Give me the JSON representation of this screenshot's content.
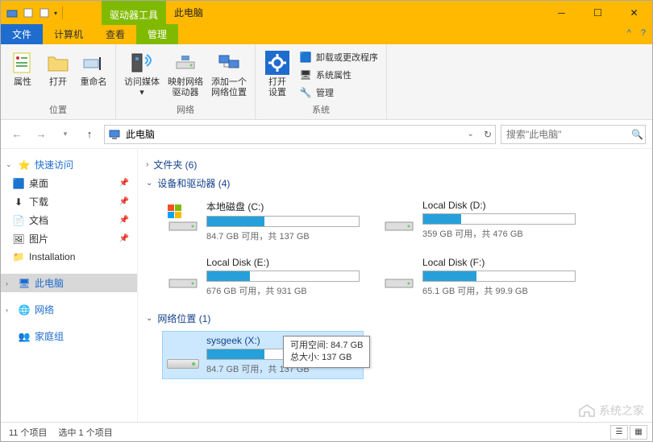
{
  "titlebar": {
    "contextual_tab": "驱动器工具",
    "title": "此电脑"
  },
  "tabs": {
    "file": "文件",
    "computer": "计算机",
    "view": "查看",
    "manage": "管理"
  },
  "ribbon": {
    "g1": {
      "properties": "属性",
      "open": "打开",
      "rename": "重命名",
      "group": "位置"
    },
    "g2": {
      "access_media": "访问媒体",
      "map_drive": "映射网络\n驱动器",
      "add_location": "添加一个\n网络位置",
      "group": "网络"
    },
    "g3": {
      "open_settings": "打开\n设置",
      "uninstall": "卸载或更改程序",
      "sys_props": "系统属性",
      "manage": "管理",
      "group": "系统"
    }
  },
  "address": {
    "path": "此电脑",
    "search_placeholder": "搜索\"此电脑\""
  },
  "nav": {
    "quick": "快速访问",
    "desktop": "桌面",
    "downloads": "下载",
    "documents": "文档",
    "pictures": "图片",
    "installation": "Installation",
    "this_pc": "此电脑",
    "network": "网络",
    "homegroup": "家庭组"
  },
  "sections": {
    "folders": "文件夹 (6)",
    "devices": "设备和驱动器 (4)",
    "netloc": "网络位置 (1)"
  },
  "drives": [
    {
      "name": "本地磁盘 (C:)",
      "stat": "84.7 GB 可用，共 137 GB",
      "fill": 38,
      "win": true
    },
    {
      "name": "Local Disk (D:)",
      "stat": "359 GB 可用，共 476 GB",
      "fill": 25,
      "win": false
    },
    {
      "name": "Local Disk (E:)",
      "stat": "676 GB 可用，共 931 GB",
      "fill": 28,
      "win": false
    },
    {
      "name": "Local Disk (F:)",
      "stat": "65.1 GB 可用，共 99.9 GB",
      "fill": 35,
      "win": false
    }
  ],
  "netdrive": {
    "name": "sysgeek (X:)",
    "stat": "84.7 GB 可用，共 137 GB",
    "fill": 38
  },
  "tooltip": {
    "line1": "可用空间: 84.7 GB",
    "line2": "总大小: 137 GB"
  },
  "status": {
    "items": "11 个项目",
    "selected": "选中 1 个项目"
  },
  "watermark": "系统之家"
}
